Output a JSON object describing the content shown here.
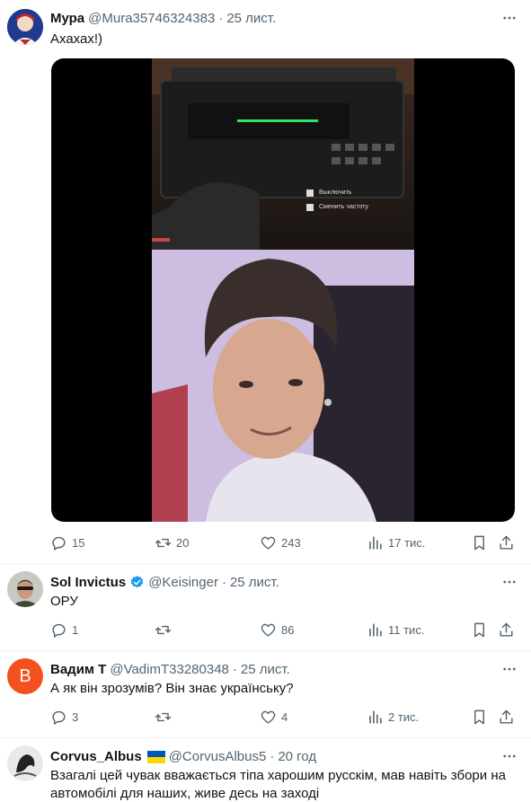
{
  "posts": [
    {
      "name": "Мура",
      "handle": "@Mura35746324383",
      "date": "25 лист.",
      "text": "Ахахах!)",
      "replies": "15",
      "reposts": "20",
      "likes": "243",
      "views": "17 тис.",
      "video_overlay": {
        "option1": "Выключить",
        "option2": "Сменить частоту"
      }
    },
    {
      "name": "Sol Invictus",
      "handle": "@Keisinger",
      "date": "25 лист.",
      "text": "ОРУ",
      "replies": "1",
      "reposts": "",
      "likes": "86",
      "views": "11 тис."
    },
    {
      "name": "Вадим Т",
      "handle": "@VadimT33280348",
      "date": "25 лист.",
      "text": "А як він зрозумів? Він знає українську?",
      "replies": "3",
      "reposts": "",
      "likes": "4",
      "views": "2 тис.",
      "avatar_letter": "B"
    },
    {
      "name": "Corvus_Albus",
      "handle": "@CorvusAlbus5",
      "date": "20 год",
      "text": "Взагалі цей чувак вважається тіпа харошим русскім, мав навіть збори на автомобілі для наших, живе десь на заході"
    }
  ],
  "colors": {
    "text": "#0f1419",
    "secondary": "#536471",
    "verified": "#1d9bf0",
    "avatar_orange": "#f4511e",
    "flag_blue": "#0057b7",
    "flag_yellow": "#ffd700"
  },
  "icons": [
    "more-icon",
    "reply-icon",
    "repost-icon",
    "like-icon",
    "views-icon",
    "bookmark-icon",
    "share-icon",
    "verified-icon",
    "ukraine-flag-icon"
  ]
}
